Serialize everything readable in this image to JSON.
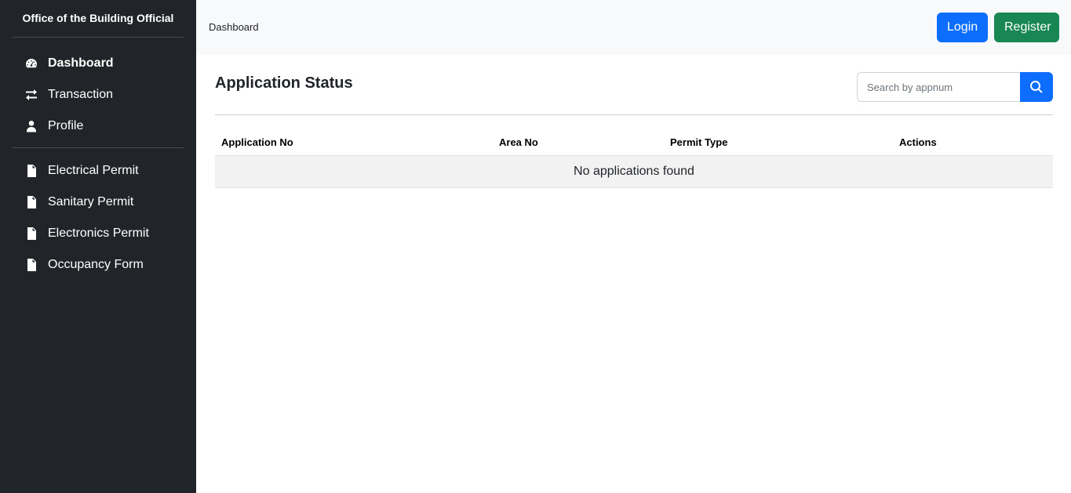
{
  "sidebar": {
    "brand": "Office of the Building Official",
    "primary_items": [
      {
        "label": "Dashboard",
        "icon": "gauge-icon",
        "active": true
      },
      {
        "label": "Transaction",
        "icon": "arrows-exchange-icon",
        "active": false
      },
      {
        "label": "Profile",
        "icon": "user-icon",
        "active": false
      }
    ],
    "secondary_items": [
      {
        "label": "Electrical Permit",
        "icon": "file-pdf-icon"
      },
      {
        "label": "Sanitary Permit",
        "icon": "file-pdf-icon"
      },
      {
        "label": "Electronics Permit",
        "icon": "file-pdf-icon"
      },
      {
        "label": "Occupancy Form",
        "icon": "file-pdf-icon"
      }
    ]
  },
  "topbar": {
    "breadcrumb": "Dashboard",
    "login_label": "Login",
    "register_label": "Register"
  },
  "main": {
    "title": "Application Status",
    "search": {
      "placeholder": "Search by appnum",
      "value": ""
    },
    "table": {
      "columns": [
        "Application No",
        "Area No",
        "Permit Type",
        "Actions"
      ],
      "empty_message": "No applications found"
    }
  },
  "colors": {
    "sidebar_bg": "#212529",
    "primary": "#0d6efd",
    "success": "#198754",
    "topbar_bg": "#f8f9fa"
  }
}
